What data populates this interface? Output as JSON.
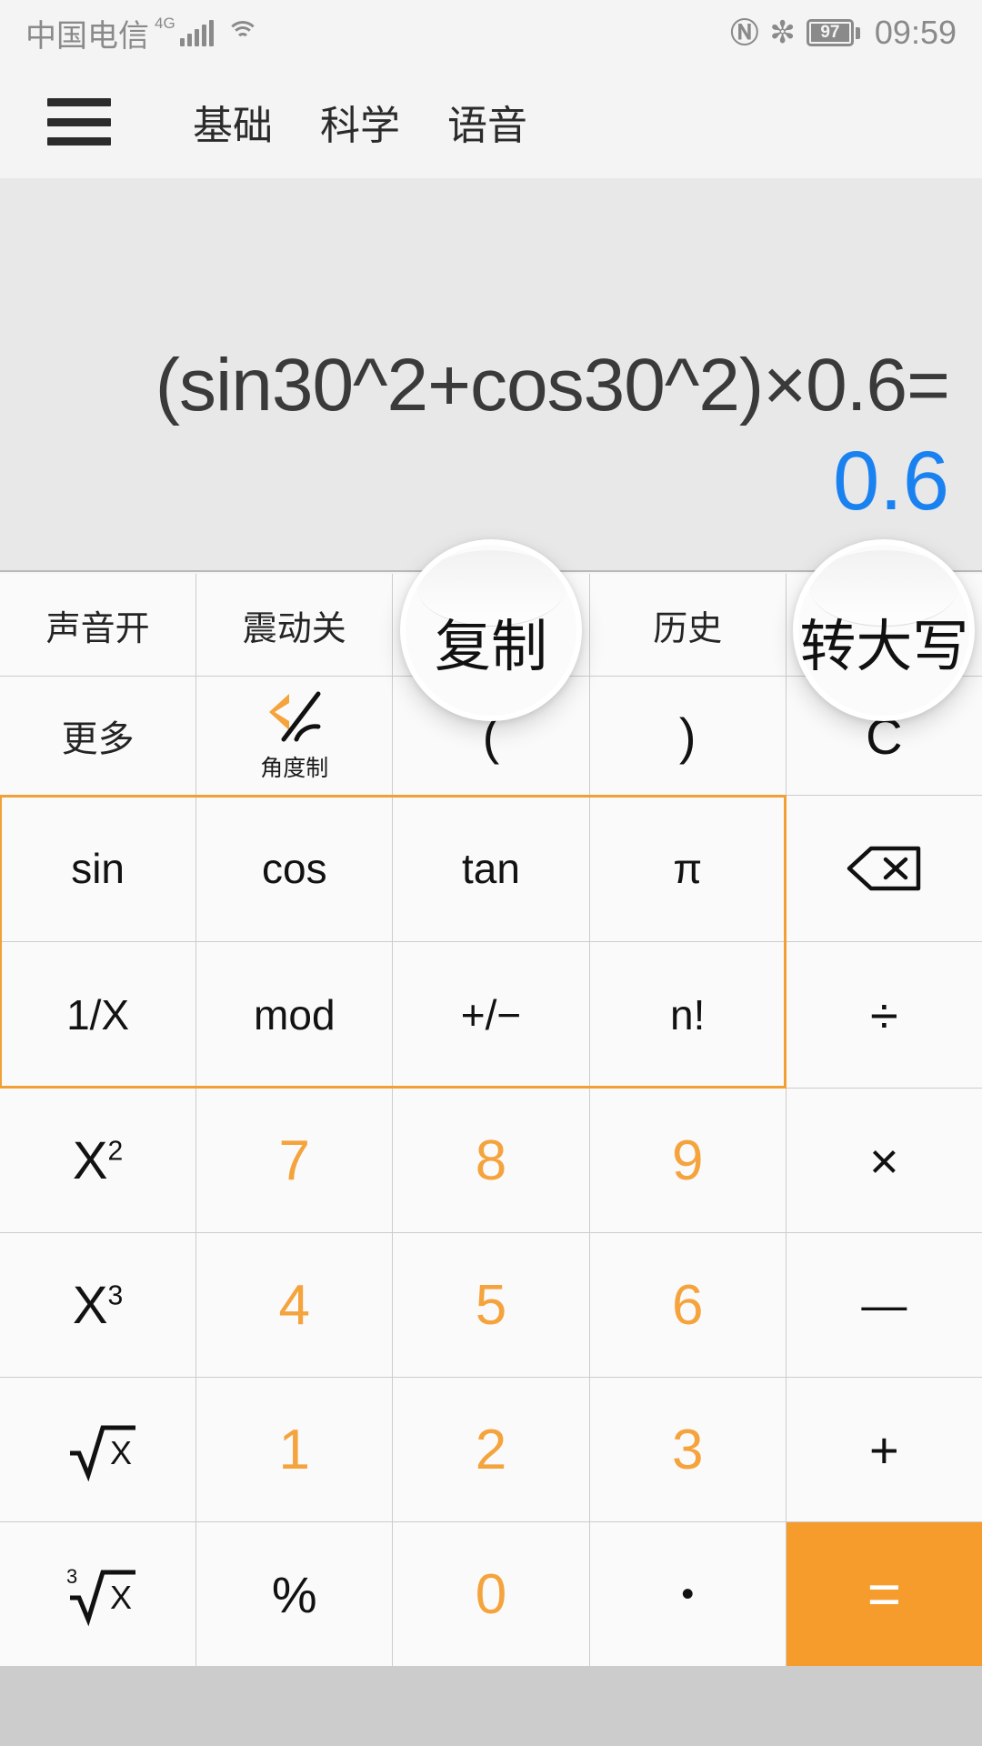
{
  "statusbar": {
    "carrier": "中国电信",
    "network": "4G",
    "battery_percent": "97",
    "time": "09:59",
    "icons": [
      "signal-bars-icon",
      "wifi-icon",
      "nfc-icon",
      "bluetooth-icon",
      "battery-icon"
    ]
  },
  "header": {
    "menu_icon": "hamburger-menu-icon",
    "tabs": [
      {
        "label": "基础",
        "active": false
      },
      {
        "label": "科学",
        "active": true
      },
      {
        "label": "语音",
        "active": false
      }
    ]
  },
  "display": {
    "expression": "(sin30^2+cos30^2)×0.6=",
    "result": "0.6",
    "result_color": "#1a82f0"
  },
  "keypad": {
    "accent_color": "#f5a33c",
    "selection_border_color": "#f0a035",
    "rows": [
      [
        {
          "label": "声音开",
          "type": "tool",
          "name": "sound-toggle"
        },
        {
          "label": "震动关",
          "type": "tool",
          "name": "vibrate-toggle"
        },
        {
          "label": "复制",
          "type": "tool",
          "name": "copy-button"
        },
        {
          "label": "历史",
          "type": "tool",
          "name": "history-button"
        },
        {
          "label": "转大写",
          "type": "tool",
          "name": "to-uppercase-button"
        }
      ],
      [
        {
          "label": "更多",
          "type": "cn",
          "name": "more-button"
        },
        {
          "label": "角度制",
          "type": "angle",
          "name": "angle-mode-button"
        },
        {
          "label": "(",
          "type": "sym",
          "name": "left-paren-key"
        },
        {
          "label": ")",
          "type": "sym",
          "name": "right-paren-key"
        },
        {
          "label": "C",
          "type": "sym",
          "name": "clear-key"
        }
      ],
      [
        {
          "label": "sin",
          "type": "fn",
          "name": "sin-key"
        },
        {
          "label": "cos",
          "type": "fn",
          "name": "cos-key"
        },
        {
          "label": "tan",
          "type": "fn",
          "name": "tan-key"
        },
        {
          "label": "π",
          "type": "fn",
          "name": "pi-key"
        },
        {
          "label": "⌫",
          "type": "icon",
          "name": "backspace-key"
        }
      ],
      [
        {
          "label": "1/X",
          "type": "fn",
          "name": "reciprocal-key"
        },
        {
          "label": "mod",
          "type": "fn",
          "name": "mod-key"
        },
        {
          "label": "+/−",
          "type": "fn",
          "name": "sign-toggle-key"
        },
        {
          "label": "n!",
          "type": "fn",
          "name": "factorial-key"
        },
        {
          "label": "÷",
          "type": "op",
          "name": "divide-key"
        }
      ],
      [
        {
          "label": "x²",
          "type": "sup2",
          "name": "square-key"
        },
        {
          "label": "7",
          "type": "num",
          "name": "digit-7-key"
        },
        {
          "label": "8",
          "type": "num",
          "name": "digit-8-key"
        },
        {
          "label": "9",
          "type": "num",
          "name": "digit-9-key"
        },
        {
          "label": "×",
          "type": "op",
          "name": "multiply-key"
        }
      ],
      [
        {
          "label": "x³",
          "type": "sup3",
          "name": "cube-key"
        },
        {
          "label": "4",
          "type": "num",
          "name": "digit-4-key"
        },
        {
          "label": "5",
          "type": "num",
          "name": "digit-5-key"
        },
        {
          "label": "6",
          "type": "num",
          "name": "digit-6-key"
        },
        {
          "label": "—",
          "type": "op",
          "name": "minus-key"
        }
      ],
      [
        {
          "label": "√x",
          "type": "root2",
          "name": "square-root-key"
        },
        {
          "label": "1",
          "type": "num",
          "name": "digit-1-key"
        },
        {
          "label": "2",
          "type": "num",
          "name": "digit-2-key"
        },
        {
          "label": "3",
          "type": "num",
          "name": "digit-3-key"
        },
        {
          "label": "+",
          "type": "op",
          "name": "plus-key"
        }
      ],
      [
        {
          "label": "∛x",
          "type": "root3",
          "name": "cube-root-key"
        },
        {
          "label": "%",
          "type": "op",
          "name": "percent-key"
        },
        {
          "label": "0",
          "type": "num",
          "name": "digit-0-key"
        },
        {
          "label": "•",
          "type": "op",
          "name": "decimal-point-key"
        },
        {
          "label": "=",
          "type": "eq",
          "name": "equals-key"
        }
      ]
    ]
  },
  "magnifiers": [
    {
      "text": "复制",
      "name": "magnifier-copy"
    },
    {
      "text": "转大写",
      "name": "magnifier-to-uppercase"
    }
  ]
}
